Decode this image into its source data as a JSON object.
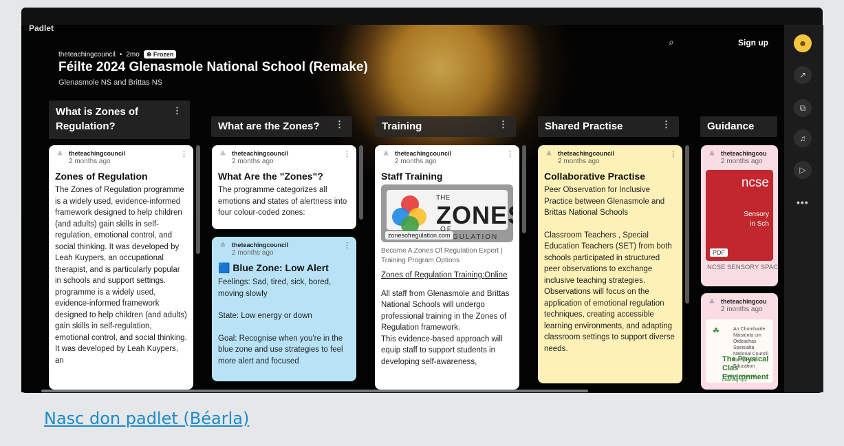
{
  "app": {
    "brand": "Padlet"
  },
  "board": {
    "owner": "theteachingcouncil",
    "age": "2mo",
    "status_badge": "❄ Frozen",
    "title": "Féilte 2024 Glenasmole National School (Remake)",
    "subtitle": "Glenasmole NS and Brittas NS"
  },
  "header": {
    "search_icon": "search-icon",
    "signup_label": "Sign up"
  },
  "rail": {
    "icons": [
      "avatar-icon",
      "share-icon",
      "remake-icon",
      "bell-icon",
      "play-icon",
      "more-icon"
    ],
    "more_label": "•••"
  },
  "columns": [
    {
      "title": "What is Zones of Regulation?"
    },
    {
      "title": "What are the Zones?"
    },
    {
      "title": "Training"
    },
    {
      "title": "Shared Practise"
    },
    {
      "title": "Guidance"
    }
  ],
  "cards": {
    "c1": {
      "author": "theteachingcouncil",
      "age": "2 months ago",
      "title": "Zones of Regulation",
      "body": "The Zones of Regulation programme is a widely used, evidence-informed framework designed to help children (and adults) gain skills in self-regulation, emotional control, and social thinking. It was developed by Leah Kuypers, an occupational therapist, and is particularly popular in schools and support settings. programme is a widely used, evidence-informed framework designed to help children (and adults) gain skills in self-regulation, emotional control, and social thinking. It was developed by Leah Kuypers, an"
    },
    "c2": {
      "author": "theteachingcouncil",
      "age": "2 months ago",
      "title": "What Are the \"Zones\"?",
      "body": "The programme categorizes all emotions and states of alertness into four colour-coded zones:"
    },
    "c3": {
      "author": "theteachingcouncil",
      "age": "2 months ago",
      "title": "🟦 Blue Zone: Low Alert",
      "line1": "Feelings: Sad, tired, sick, bored, moving slowly",
      "line2": "State: Low energy or down",
      "line3": "Goal: Recognise when you're in the blue zone and use strategies to feel more alert and focused"
    },
    "c4": {
      "author": "theteachingcouncil",
      "age": "2 months ago",
      "title": "Staff Training",
      "logo_the": "THE",
      "logo_main": "ZONES",
      "logo_sub": "OF REGULATION",
      "domain": "zonesofregulation.com",
      "preview_desc": "Become A Zones Of Regulation Expert | Training Program Options",
      "link_text": "Zones of Regulation Training:",
      "link_suffix": "Online",
      "body": "All staff from Glenasmole and Brittas National Schools will undergo professional training in the Zones of Regulation framework.",
      "body2": "This evidence-based approach will equip staff to support students in developing self-awareness,"
    },
    "c5": {
      "author": "theteachingcouncil",
      "age": "2 months ago",
      "title": "Collaborative Practise",
      "line1": "Peer Observation for Inclusive Practice between Glenasmole and Brittas National Schools",
      "line2": "Classroom Teachers , Special Education Teachers (SET) from both schools  participated in structured peer observations to exchange inclusive teaching strategies. Observations will focus on the application of emotional regulation techniques, creating accessible learning environments, and adapting classroom settings to support diverse needs."
    },
    "c6": {
      "author": "theteachingcou",
      "age": "2 months ago",
      "pdf_brand": "ncse",
      "pdf_title": "Sensory\nin Sch",
      "pdf_tag": "PDF",
      "caption": "NCSE SENSORY SPAC"
    },
    "c7": {
      "author": "theteachingcou",
      "age": "2 months ago",
      "crest": "☘",
      "org": "An Chomhairle Náisiúnta um Oideachas Speisialta\nNational Council for Special Education",
      "doc_title": "The Physical Clas\nEnvironment",
      "doc_sub": "Creating Universal Learning Spa"
    }
  },
  "footer": {
    "link_text": "Nasc don padlet (Béarla)"
  },
  "colors": {
    "blue_card": "#b8e3f7",
    "yellow_card": "#fdf1b8",
    "pink_card": "#f9dde2",
    "link": "#1a8bcd"
  }
}
